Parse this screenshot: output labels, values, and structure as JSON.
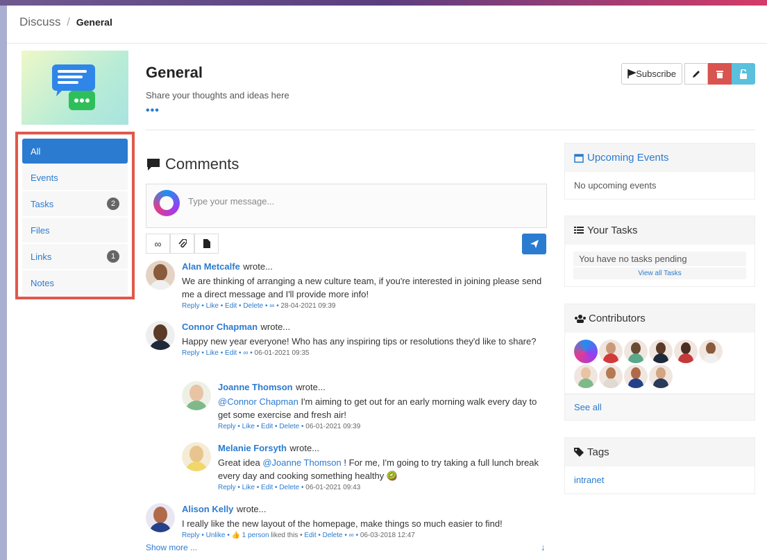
{
  "breadcrumb": {
    "root": "Discuss",
    "separator": "/",
    "current": "General"
  },
  "header": {
    "title": "General",
    "subtitle": "Share your thoughts and ideas here",
    "more": "•••",
    "subscribe_label": "Subscribe"
  },
  "sidebar": {
    "items": [
      {
        "label": "All",
        "badge": ""
      },
      {
        "label": "Events",
        "badge": ""
      },
      {
        "label": "Tasks",
        "badge": "2"
      },
      {
        "label": "Files",
        "badge": ""
      },
      {
        "label": "Links",
        "badge": "1"
      },
      {
        "label": "Notes",
        "badge": ""
      }
    ]
  },
  "comments": {
    "heading": "Comments",
    "placeholder": "Type your message...",
    "items": [
      {
        "author": "Alan Metcalfe",
        "wrote": "wrote...",
        "text": "We are thinking of arranging a new culture team, if you're interested in joining please send me a direct message and I'll provide more info!",
        "actions": "Reply • Like • Edit • Delete •",
        "date": "28-04-2021 09:39"
      },
      {
        "author": "Connor Chapman",
        "wrote": "wrote...",
        "text": "Happy new year everyone! Who has any inspiring tips or resolutions they'd like to share?",
        "actions": "Reply • Like • Edit •",
        "date": "06-01-2021 09:35"
      },
      {
        "author": "Joanne Thomson",
        "wrote": "wrote...",
        "mention": "@Connor Chapman",
        "text": " I'm aiming to get out for an early morning walk every day to get some exercise and fresh air!",
        "actions": "Reply • Like • Edit • Delete •",
        "date": "06-01-2021 09:39"
      },
      {
        "author": "Melanie Forsyth",
        "wrote": "wrote...",
        "pre": "Great idea ",
        "mention": "@Joanne Thomson",
        "text": " ! For me, I'm going to try taking a full lunch break every day and cooking something healthy 🥝",
        "actions": "Reply • Like • Edit • Delete •",
        "date": "06-01-2021 09:43"
      },
      {
        "author": "Alison Kelly",
        "wrote": "wrote...",
        "text": "I really like the new layout of the homepage, make things so much easier to find!",
        "actions_pre": "Reply • Unlike •",
        "likes": "1 person",
        "liked_this": "liked this • ",
        "actions": "Edit • Delete •",
        "date": "06-03-2018 12:47"
      }
    ],
    "show_more": "Show more ...",
    "arrow": "↓"
  },
  "right": {
    "events": {
      "title": "Upcoming Events",
      "empty": "No upcoming events"
    },
    "tasks": {
      "title": "Your Tasks",
      "empty": "You have no tasks pending",
      "view_all": "View all Tasks"
    },
    "contributors": {
      "title": "Contributors",
      "see_all": "See all"
    },
    "tags": {
      "title": "Tags",
      "items": [
        "intranet"
      ]
    }
  },
  "colors": {
    "accent": "#2b7bd0",
    "danger": "#d9534f",
    "info": "#5bc0de",
    "highlight": "#e0584a"
  }
}
